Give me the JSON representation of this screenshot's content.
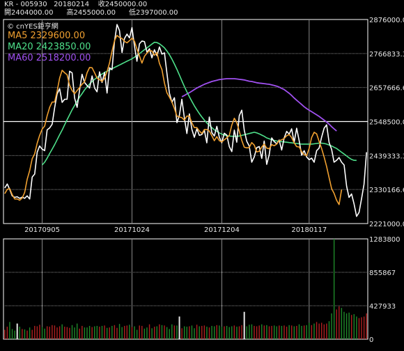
{
  "header": {
    "line1": "KR - 005930   20180214    收2450000.00",
    "line2": "開2404000.00      高2455000.00      低2397000.00"
  },
  "watermark": "© cnYES鉅亨網",
  "colors": {
    "price": "#ffffff",
    "ma5": "#f0a030",
    "ma20": "#4ee08a",
    "ma60": "#a050f0",
    "vol_up": "#b02020",
    "vol_down": "#1f8a2a",
    "grid": "#8a8a8a",
    "frame": "#ffffff",
    "axis_text": "#e6e6e6"
  },
  "chart_data": [
    {
      "type": "line",
      "name": "price",
      "legend": [
        {
          "label": "MA5 2329600.00",
          "color": "#f0a030"
        },
        {
          "label": "MA20 2423850.00",
          "color": "#4ee08a"
        },
        {
          "label": "MA60 2518200.00",
          "color": "#a050f0"
        }
      ],
      "y_ticks": [
        "2876000.00",
        "2766833.33",
        "2657666.6",
        "2548500.00",
        "2439333.3",
        "2330166.6",
        "2221000.0"
      ],
      "ylim": [
        2221000,
        2876000
      ],
      "x_ticks": [
        {
          "label": "20170905",
          "index": 15
        },
        {
          "label": "20171024",
          "index": 51
        },
        {
          "label": "20171204",
          "index": 87
        },
        {
          "label": "20180117",
          "index": 122
        }
      ],
      "n_sessions": 146,
      "series": [
        {
          "name": "MA5",
          "key": "ma5",
          "first_index": 0,
          "values": [
            2317000,
            2331000,
            2333000,
            2314000,
            2300000,
            2300000,
            2296000,
            2303000,
            2321000,
            2363000,
            2391000,
            2429000,
            2445000,
            2479000,
            2504000,
            2524000,
            2534000,
            2567000,
            2594000,
            2611000,
            2611000,
            2646000,
            2688000,
            2713000,
            2705000,
            2699000,
            2665000,
            2648000,
            2638000,
            2648000,
            2658000,
            2668000,
            2676000,
            2705000,
            2722000,
            2721000,
            2705000,
            2688000,
            2683000,
            2677000,
            2688000,
            2709000,
            2736000,
            2774000,
            2808000,
            2825000,
            2818000,
            2815000,
            2806000,
            2801000,
            2808000,
            2816000,
            2806000,
            2781000,
            2759000,
            2736000,
            2758000,
            2768000,
            2776000,
            2775000,
            2761000,
            2770000,
            2735000,
            2715000,
            2672000,
            2641000,
            2627000,
            2611000,
            2590000,
            2566000,
            2563000,
            2561000,
            2553000,
            2566000,
            2566000,
            2544000,
            2529000,
            2529000,
            2518000,
            2510000,
            2523000,
            2523000,
            2518000,
            2503000,
            2487000,
            2500000,
            2487000,
            2483000,
            2490000,
            2496000,
            2504000,
            2537000,
            2559000,
            2545000,
            2518000,
            2488000,
            2466000,
            2464000,
            2465000,
            2481000,
            2473000,
            2451000,
            2453000,
            2467000,
            2476000,
            2463000,
            2461000,
            2474000,
            2471000,
            2476000,
            2487000,
            2490000,
            2494000,
            2503000,
            2507000,
            2497000,
            2480000,
            2468000,
            2467000,
            2452000,
            2442000,
            2439000,
            2462000,
            2497000,
            2514000,
            2509000,
            2485000,
            2462000,
            2435000,
            2404000,
            2368000,
            2333000,
            2318000,
            2296000,
            2282000,
            2330000
          ]
        },
        {
          "name": "MA20",
          "key": "ma20",
          "first_index": 15,
          "values": [
            2409000,
            2418000,
            2431000,
            2446000,
            2460000,
            2474000,
            2490000,
            2506000,
            2521000,
            2538000,
            2554000,
            2570000,
            2586000,
            2600000,
            2614000,
            2627000,
            2638000,
            2650000,
            2660000,
            2669000,
            2677000,
            2684000,
            2690000,
            2696000,
            2701000,
            2706000,
            2710000,
            2714000,
            2718000,
            2722000,
            2726000,
            2730000,
            2734000,
            2738000,
            2742000,
            2746000,
            2750000,
            2755000,
            2760000,
            2766000,
            2773000,
            2779000,
            2785000,
            2791000,
            2797000,
            2803000,
            2802000,
            2798000,
            2792000,
            2785000,
            2775000,
            2763000,
            2749000,
            2733000,
            2716000,
            2698000,
            2679000,
            2661000,
            2644000,
            2628000,
            2613000,
            2599000,
            2586000,
            2574000,
            2563000,
            2553000,
            2544000,
            2536000,
            2529000,
            2522000,
            2517000,
            2512000,
            2508000,
            2505000,
            2503000,
            2502000,
            2501000,
            2501000,
            2501000,
            2502000,
            2504000,
            2506000,
            2508000,
            2510000,
            2512000,
            2514000,
            2512000,
            2509000,
            2505000,
            2501000,
            2496000,
            2493000,
            2490000,
            2488000,
            2486000,
            2485000,
            2484000,
            2483000,
            2482000,
            2481000,
            2480000,
            2479000,
            2478000,
            2477000,
            2476000,
            2476000,
            2476000,
            2476000,
            2476000,
            2477000,
            2478000,
            2479000,
            2479000,
            2478000,
            2476000,
            2473000,
            2470000,
            2466000,
            2462000,
            2456000,
            2450000,
            2444000,
            2438000,
            2432000,
            2427000,
            2424000,
            2423850
          ]
        },
        {
          "name": "MA60",
          "key": "ma60",
          "first_index": 71,
          "values": [
            2628000,
            2632000,
            2637000,
            2641000,
            2646000,
            2651000,
            2656000,
            2660000,
            2664000,
            2668000,
            2671000,
            2674000,
            2677000,
            2679000,
            2681000,
            2683000,
            2684000,
            2685000,
            2686000,
            2686000,
            2686000,
            2686000,
            2685000,
            2684000,
            2683000,
            2682000,
            2680000,
            2678000,
            2677000,
            2675000,
            2673000,
            2672000,
            2671000,
            2670000,
            2669000,
            2668000,
            2666000,
            2664000,
            2662000,
            2659000,
            2655000,
            2651000,
            2645000,
            2639000,
            2632000,
            2624000,
            2617000,
            2610000,
            2603000,
            2596000,
            2590000,
            2585000,
            2580000,
            2575000,
            2570000,
            2565000,
            2559000,
            2553000,
            2547000,
            2540000,
            2532000,
            2525000,
            2518200
          ]
        },
        {
          "name": "Price",
          "key": "price",
          "first_index": 0,
          "values": [
            2335000,
            2348000,
            2330000,
            2310000,
            2305000,
            2307000,
            2302000,
            2306000,
            2302000,
            2310000,
            2300000,
            2370000,
            2380000,
            2450000,
            2470000,
            2460000,
            2455000,
            2522000,
            2528000,
            2540000,
            2592000,
            2637000,
            2654000,
            2610000,
            2620000,
            2620000,
            2710000,
            2705000,
            2624000,
            2594000,
            2650000,
            2700000,
            2674000,
            2664000,
            2656000,
            2695000,
            2656000,
            2644000,
            2708000,
            2674000,
            2706000,
            2640000,
            2721000,
            2715000,
            2806000,
            2860000,
            2840000,
            2770000,
            2815000,
            2829000,
            2817000,
            2850000,
            2790000,
            2742000,
            2798000,
            2807000,
            2805000,
            2771000,
            2782000,
            2753000,
            2779000,
            2760000,
            2788000,
            2765000,
            2769000,
            2704000,
            2640000,
            2610000,
            2625000,
            2545000,
            2568000,
            2620000,
            2560000,
            2510000,
            2573000,
            2523000,
            2498000,
            2525000,
            2504000,
            2507000,
            2520000,
            2480000,
            2563000,
            2513000,
            2502000,
            2533000,
            2498000,
            2480000,
            2511000,
            2505000,
            2468000,
            2452000,
            2521000,
            2482000,
            2567000,
            2585000,
            2520000,
            2485000,
            2470000,
            2418000,
            2435000,
            2465000,
            2468000,
            2430000,
            2486000,
            2411000,
            2442000,
            2496000,
            2484000,
            2477000,
            2489000,
            2457000,
            2496000,
            2517000,
            2508000,
            2525000,
            2482000,
            2527000,
            2487000,
            2440000,
            2455000,
            2435000,
            2426000,
            2431000,
            2418000,
            2455000,
            2463000,
            2498000,
            2527000,
            2538000,
            2481000,
            2459000,
            2418000,
            2424000,
            2433000,
            2418000,
            2409000,
            2341000,
            2305000,
            2316000,
            2284000,
            2244000,
            2257000,
            2300000,
            2347000,
            2450000
          ]
        }
      ]
    },
    {
      "type": "bar",
      "name": "volume",
      "y_ticks": [
        "1283800",
        "855867",
        "427933",
        "0"
      ],
      "ylim": [
        0,
        1283800
      ],
      "values": [
        120000,
        160000,
        220000,
        130000,
        110000,
        140000,
        160000,
        130000,
        125000,
        110000,
        150000,
        120000,
        170000,
        165000,
        185000,
        155000,
        135000,
        165000,
        160000,
        180000,
        175000,
        150000,
        165000,
        190000,
        160000,
        155000,
        145000,
        180000,
        150000,
        200000,
        135000,
        170000,
        150000,
        150000,
        170000,
        155000,
        165000,
        170000,
        160000,
        170000,
        175000,
        145000,
        150000,
        170000,
        180000,
        145000,
        195000,
        155000,
        170000,
        175000,
        185000,
        155000,
        165000,
        120000,
        175000,
        170000,
        135000,
        150000,
        190000,
        140000,
        160000,
        165000,
        190000,
        180000,
        175000,
        155000,
        130000,
        190000,
        175000,
        175000,
        160000,
        140000,
        165000,
        160000,
        165000,
        175000,
        140000,
        185000,
        165000,
        170000,
        175000,
        160000,
        150000,
        170000,
        165000,
        180000,
        175000,
        160000,
        165000,
        170000,
        155000,
        165000,
        175000,
        160000,
        165000,
        180000,
        175000,
        165000,
        185000,
        190000,
        170000,
        165000,
        175000,
        190000,
        175000,
        180000,
        165000,
        170000,
        175000,
        165000,
        175000,
        170000,
        175000,
        160000,
        180000,
        175000,
        165000,
        170000,
        190000,
        170000,
        175000,
        180000,
        210000,
        180000,
        200000,
        220000,
        200000,
        210000,
        190000,
        200000,
        230000,
        330000,
        1283800,
        380000,
        420000,
        400000,
        350000,
        330000,
        340000,
        310000,
        320000,
        290000,
        270000,
        280000,
        290000,
        330000
      ],
      "highlight_index": [
        5,
        70,
        96
      ],
      "highlight_values": [
        200000,
        290000,
        350000
      ]
    }
  ]
}
